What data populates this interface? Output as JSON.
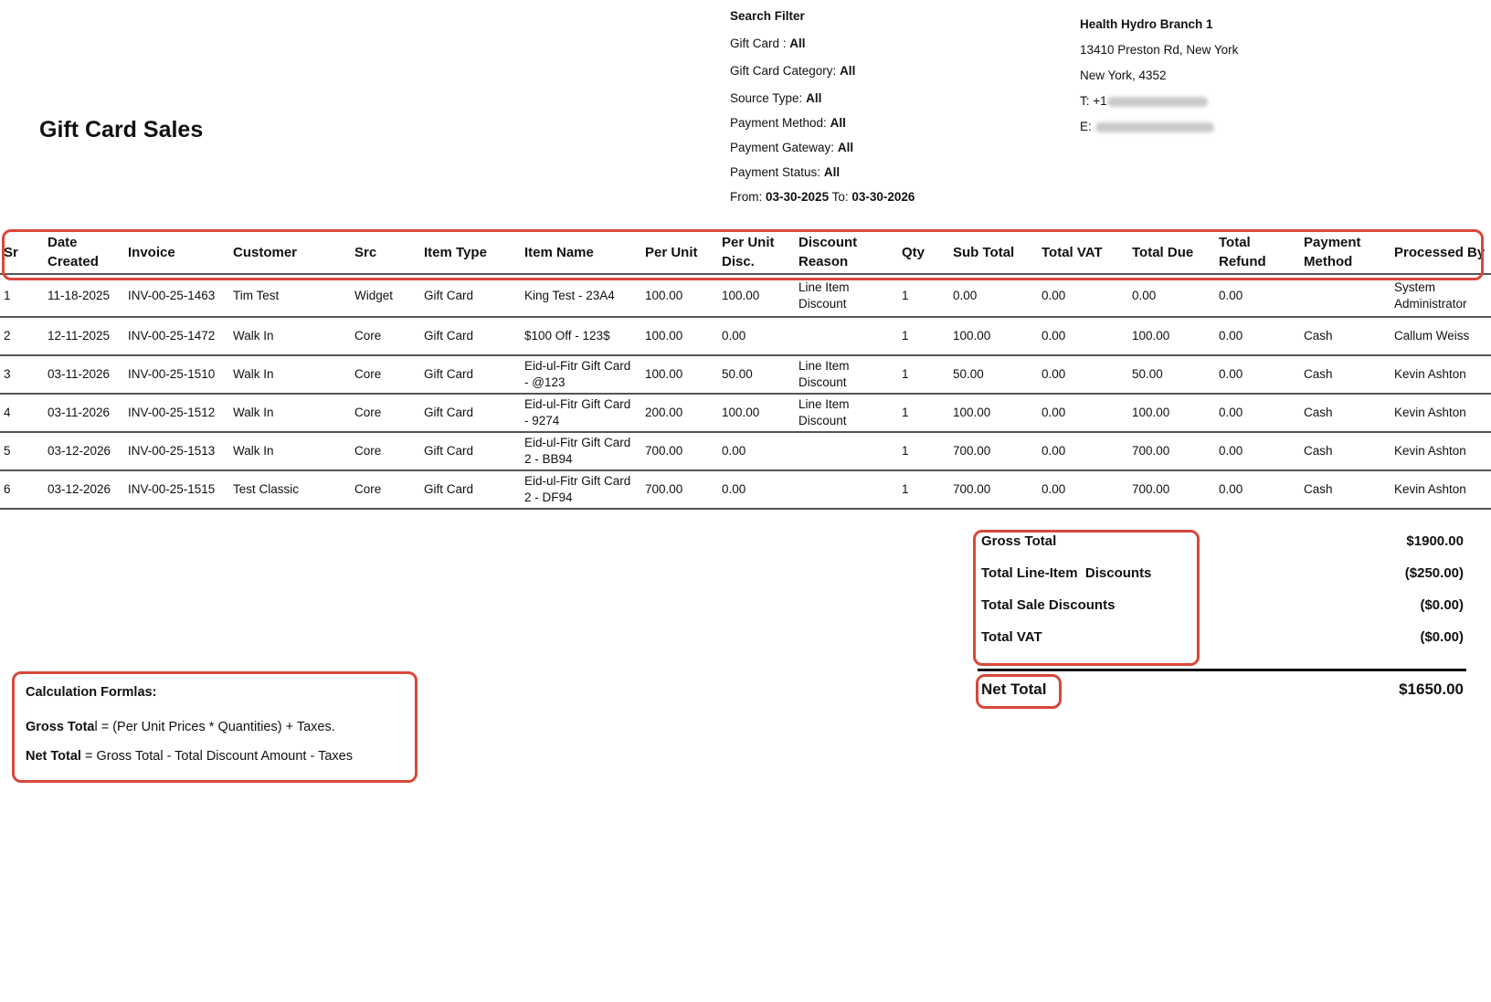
{
  "report_title": "Gift Card Sales",
  "search_filter": {
    "heading": "Search Filter",
    "gift_card_label": "Gift Card :",
    "gift_card_value": "All",
    "gift_card_category_label": "Gift Card Category:",
    "gift_card_category_value": "All",
    "source_type_label": "Source Type:",
    "source_type_value": "All",
    "payment_method_label": "Payment Method:",
    "payment_method_value": "All",
    "payment_gateway_label": "Payment Gateway:",
    "payment_gateway_value": "All",
    "payment_status_label": "Payment Status:",
    "payment_status_value": "All",
    "from_label": "From:",
    "from_value": "03-30-2025",
    "to_label": "To:",
    "to_value": "03-30-2026"
  },
  "branch": {
    "name": "Health Hydro Branch 1",
    "address_line1": "13410 Preston Rd, New York",
    "address_line2": "New York, 4352",
    "phone_label": "T: +1",
    "email_label": "E:"
  },
  "table": {
    "columns": [
      "Sr",
      "Date Created",
      "Invoice",
      "Customer",
      "Src",
      "Item Type",
      "Item Name",
      "Per Unit",
      "Per Unit Disc.",
      "Discount Reason",
      "Qty",
      "Sub Total",
      "Total VAT",
      "Total Due",
      "Total Refund",
      "Payment Method",
      "Processed By"
    ],
    "rows": [
      [
        "1",
        "11-18-2025",
        "INV-00-25-1463",
        "Tim Test",
        "Widget",
        "Gift Card",
        "King Test - 23A4",
        "100.00",
        "100.00",
        "Line Item Discount",
        "1",
        "0.00",
        "0.00",
        "0.00",
        "0.00",
        "",
        "System Administrator"
      ],
      [
        "2",
        "12-11-2025",
        "INV-00-25-1472",
        "Walk In",
        "Core",
        "Gift Card",
        "$100 Off - 123$",
        "100.00",
        "0.00",
        "",
        "1",
        "100.00",
        "0.00",
        "100.00",
        "0.00",
        "Cash",
        "Callum Weiss"
      ],
      [
        "3",
        "03-11-2026",
        "INV-00-25-1510",
        "Walk In",
        "Core",
        "Gift Card",
        "Eid-ul-Fitr Gift Card - @123",
        "100.00",
        "50.00",
        "Line Item Discount",
        "1",
        "50.00",
        "0.00",
        "50.00",
        "0.00",
        "Cash",
        "Kevin Ashton"
      ],
      [
        "4",
        "03-11-2026",
        "INV-00-25-1512",
        "Walk In",
        "Core",
        "Gift Card",
        "Eid-ul-Fitr Gift Card - 9274",
        "200.00",
        "100.00",
        "Line Item Discount",
        "1",
        "100.00",
        "0.00",
        "100.00",
        "0.00",
        "Cash",
        "Kevin Ashton"
      ],
      [
        "5",
        "03-12-2026",
        "INV-00-25-1513",
        "Walk In",
        "Core",
        "Gift Card",
        "Eid-ul-Fitr Gift Card 2 - BB94",
        "700.00",
        "0.00",
        "",
        "1",
        "700.00",
        "0.00",
        "700.00",
        "0.00",
        "Cash",
        "Kevin Ashton"
      ],
      [
        "6",
        "03-12-2026",
        "INV-00-25-1515",
        "Test Classic",
        "Core",
        "Gift Card",
        "Eid-ul-Fitr Gift Card 2 - DF94",
        "700.00",
        "0.00",
        "",
        "1",
        "700.00",
        "0.00",
        "700.00",
        "0.00",
        "Cash",
        "Kevin Ashton"
      ]
    ]
  },
  "totals": {
    "gross_total_label": "Gross Total",
    "gross_total_value": "$1900.00",
    "line_item_discounts_label": "Total Line-Item  Discounts",
    "line_item_discounts_value": "($250.00)",
    "sale_discounts_label": "Total Sale Discounts",
    "sale_discounts_value": "($0.00)",
    "vat_label": "Total VAT",
    "vat_value": "($0.00)",
    "net_total_label": "Net Total",
    "net_total_value": "$1650.00"
  },
  "formulas": {
    "title": "Calculation Formlas:",
    "gross_label_a": "Gross Tota",
    "gross_label_b": "l",
    "gross_text": " = (Per Unit Prices * Quantities) + Taxes.",
    "net_label": "Net Total",
    "net_text": " = Gross Total - Total Discount Amount - Taxes"
  },
  "colors": {
    "annotation_border": "#d9473a",
    "rule": "#555555"
  }
}
